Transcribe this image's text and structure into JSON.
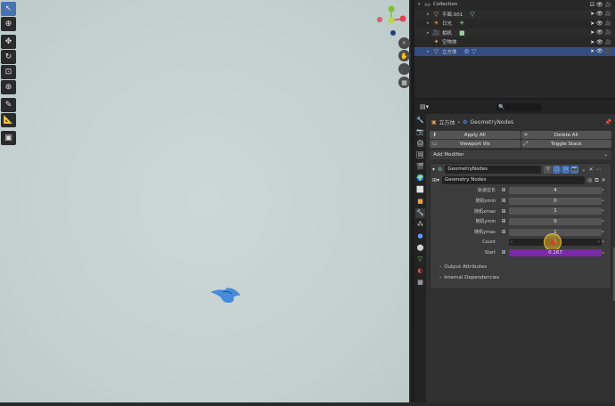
{
  "viewport": {
    "tools": [
      {
        "name": "select-box-tool",
        "glyph": "↖",
        "active": true
      },
      {
        "name": "cursor-tool",
        "glyph": "⊕"
      },
      {
        "name": "move-tool",
        "glyph": "✥"
      },
      {
        "name": "rotate-tool",
        "glyph": "↻"
      },
      {
        "name": "scale-tool",
        "glyph": "⊡"
      },
      {
        "name": "transform-tool",
        "glyph": "⊛"
      },
      {
        "name": "annotate-tool",
        "glyph": "✎"
      },
      {
        "name": "measure-tool",
        "glyph": "📐"
      },
      {
        "name": "add-cube-tool",
        "glyph": "▣"
      }
    ],
    "gizmo": {
      "x_color": "#e0414f",
      "y_color": "#7fbf2f",
      "z_color": "#3a76e0"
    },
    "nav_buttons": [
      "zoom-icon",
      "hand-icon",
      "camera-icon",
      "grid-icon"
    ]
  },
  "outliner": {
    "rows": [
      {
        "arrow": "▾",
        "icon": "▭",
        "label": "Collection",
        "extra": "",
        "selected": false
      },
      {
        "arrow": "▸",
        "icon": "▽",
        "label": "平面.001",
        "extra": "▽",
        "selected": false
      },
      {
        "arrow": "▸",
        "icon": "☀",
        "label": "日光",
        "extra": "☀",
        "selected": false
      },
      {
        "arrow": "▸",
        "icon": "🎥",
        "label": "相机",
        "extra": "■",
        "selected": false
      },
      {
        "arrow": "",
        "icon": "✦",
        "label": "空物体",
        "extra": "",
        "selected": false
      },
      {
        "arrow": "▸",
        "icon": "▽",
        "label": "立方体",
        "extra": "⚙ ▽",
        "selected": true
      }
    ]
  },
  "properties": {
    "search_placeholder": "🔍",
    "breadcrumb": {
      "object": "立方体",
      "sep": "›",
      "modifier": "GeometryNodes"
    },
    "buttons": {
      "apply_all": "Apply All",
      "delete_all": "Delete All",
      "viewport_vis": "Viewport Vis",
      "toggle_stack": "Toggle Stack"
    },
    "add_modifier": "Add Modifier",
    "modifier": {
      "name": "GeometryNodes",
      "node_group": "Geometry Nodes",
      "params": [
        {
          "label": "轨道拉长",
          "value": "4",
          "style": "grey"
        },
        {
          "label": "随机xmin",
          "value": "0",
          "style": "grey"
        },
        {
          "label": "随机xmax",
          "value": "1",
          "style": "grey"
        },
        {
          "label": "随机ymin",
          "value": "0",
          "style": "grey"
        },
        {
          "label": "随机ymax",
          "value": "1",
          "style": "grey"
        },
        {
          "label": "Count",
          "value": "1",
          "style": "dark"
        },
        {
          "label": "Start",
          "value": "0.167",
          "style": "purple"
        }
      ],
      "sections": [
        "Output Attributes",
        "Internal Dependencies"
      ]
    },
    "tabs": [
      "🔧",
      "🎥",
      "🖨",
      "🖼",
      "🌍",
      "🎬",
      "⬜",
      "🔧",
      "⚡",
      "●",
      "⬤",
      "▽",
      "◐",
      "▦"
    ]
  }
}
